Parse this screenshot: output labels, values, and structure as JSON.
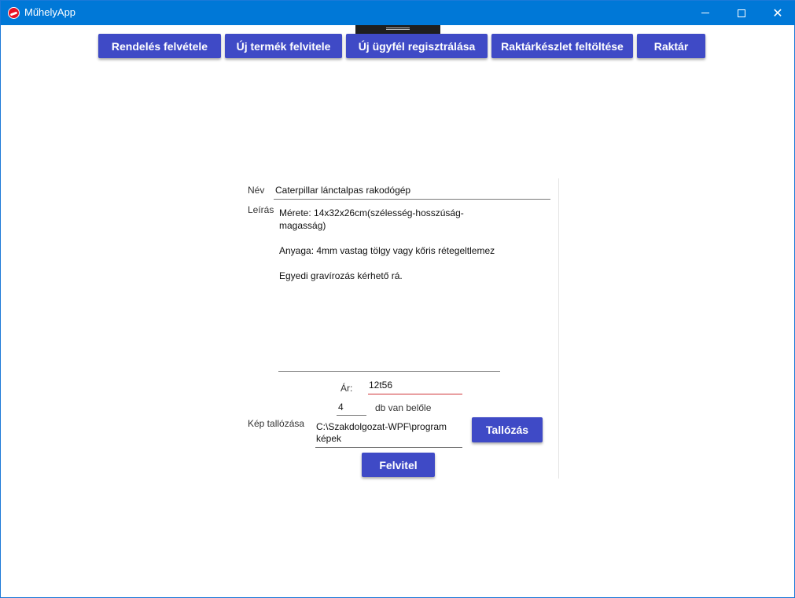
{
  "window": {
    "title": "MűhelyApp"
  },
  "nav": {
    "order": "Rendelés felvétele",
    "new_product": "Új termék felvitele",
    "new_customer": "Új ügyfél regisztrálása",
    "stock_upload": "Raktárkészlet feltöltése",
    "warehouse": "Raktár"
  },
  "form": {
    "name_label": "Név",
    "name_value": "Caterpillar lánctalpas rakodógép",
    "description_label": "Leírás",
    "description_lines": [
      "Mérete: 14x32x26cm(szélesség-hosszúság-magasság)",
      "Anyaga: 4mm vastag tölgy vagy kőris rétegeltlemez",
      "Egyedi gravírozás kérhető rá."
    ],
    "price_label": "Ár:",
    "price_value": "12t56",
    "quantity_value": "4",
    "quantity_suffix": "db van belőle",
    "image_label": "Kép tallózása",
    "image_path": "C:\\Szakdolgozat-WPF\\program képek",
    "browse_button": "Tallózás",
    "submit_button": "Felvitel"
  },
  "colors": {
    "titlebar": "#0078d7",
    "button": "#3f4ac6",
    "error_underline": "#d13438"
  }
}
